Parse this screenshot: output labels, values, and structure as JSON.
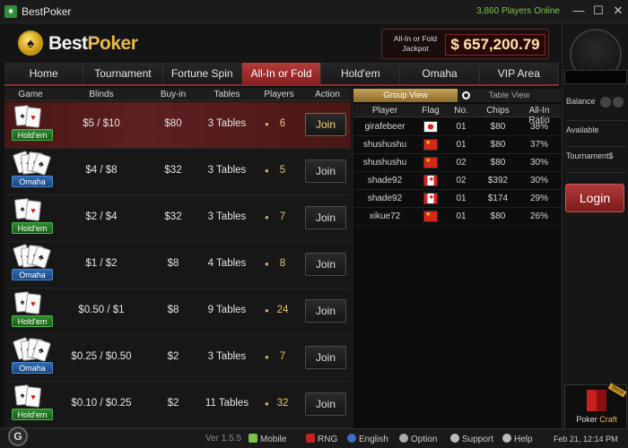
{
  "window": {
    "title": "BestPoker",
    "players_online": "3,860 Players Online",
    "minimize": "—",
    "maximize": "☐",
    "close": "✕"
  },
  "header": {
    "logo_best": "Best",
    "logo_poker": "Poker",
    "jackpot_label": "All-In or Fold Jackpot",
    "jackpot_value": "$ 657,200.79"
  },
  "tabs": [
    {
      "label": "Home"
    },
    {
      "label": "Tournament"
    },
    {
      "label": "Fortune Spin"
    },
    {
      "label": "All-In or Fold"
    },
    {
      "label": "Hold'em"
    },
    {
      "label": "Omaha"
    },
    {
      "label": "VIP Area"
    }
  ],
  "active_tab_index": 3,
  "lobby": {
    "columns": [
      "Game",
      "Blinds",
      "Buy-in",
      "Tables",
      "Players",
      "Action"
    ],
    "rows": [
      {
        "game": "Hold'em",
        "blinds": "$5 / $10",
        "buyin": "$80",
        "tables": "3 Tables",
        "players": "6",
        "action": "Join",
        "selected": true
      },
      {
        "game": "Omaha",
        "blinds": "$4 / $8",
        "buyin": "$32",
        "tables": "3 Tables",
        "players": "5",
        "action": "Join"
      },
      {
        "game": "Hold'em",
        "blinds": "$2 / $4",
        "buyin": "$32",
        "tables": "3 Tables",
        "players": "7",
        "action": "Join"
      },
      {
        "game": "Omaha",
        "blinds": "$1 / $2",
        "buyin": "$8",
        "tables": "4 Tables",
        "players": "8",
        "action": "Join"
      },
      {
        "game": "Hold'em",
        "blinds": "$0.50 / $1",
        "buyin": "$8",
        "tables": "9 Tables",
        "players": "24",
        "action": "Join"
      },
      {
        "game": "Omaha",
        "blinds": "$0.25 / $0.50",
        "buyin": "$2",
        "tables": "3 Tables",
        "players": "7",
        "action": "Join"
      },
      {
        "game": "Hold'em",
        "blinds": "$0.10 / $0.25",
        "buyin": "$2",
        "tables": "11 Tables",
        "players": "32",
        "action": "Join"
      }
    ]
  },
  "player_view": {
    "group_view": "Group View",
    "table_view": "Table View",
    "columns": [
      "Player",
      "Flag",
      "No.",
      "Chips",
      "All-In Ratio"
    ],
    "rows": [
      {
        "player": "girafebeer",
        "flag": "JP",
        "no": "01",
        "chips": "$80",
        "ratio": "38%"
      },
      {
        "player": "shushushu",
        "flag": "CN",
        "no": "01",
        "chips": "$80",
        "ratio": "37%"
      },
      {
        "player": "shushushu",
        "flag": "CN",
        "no": "02",
        "chips": "$80",
        "ratio": "30%"
      },
      {
        "player": "shade92",
        "flag": "CA",
        "no": "02",
        "chips": "$392",
        "ratio": "30%"
      },
      {
        "player": "shade92",
        "flag": "CA",
        "no": "01",
        "chips": "$174",
        "ratio": "29%"
      },
      {
        "player": "xikue72",
        "flag": "CN",
        "no": "01",
        "chips": "$80",
        "ratio": "26%"
      }
    ]
  },
  "account": {
    "balance_label": "Balance",
    "available_label": "Available",
    "tournament_label": "Tournament$",
    "login_label": "Login",
    "pokercraft_poker": "Poker",
    "pokercraft_craft": "Craft",
    "pokercraft_beta": "Beta"
  },
  "statusbar": {
    "logo": "G",
    "version": "Ver 1.5.5",
    "mobile": "Mobile",
    "rng": "RNG",
    "language": "English",
    "option": "Option",
    "support": "Support",
    "help": "Help",
    "datetime": "Feb 21, 12:14 PM"
  },
  "colors": {
    "accent_red": "#8a1f1f",
    "gold": "#e9b949",
    "online_green": "#7cc24c"
  }
}
